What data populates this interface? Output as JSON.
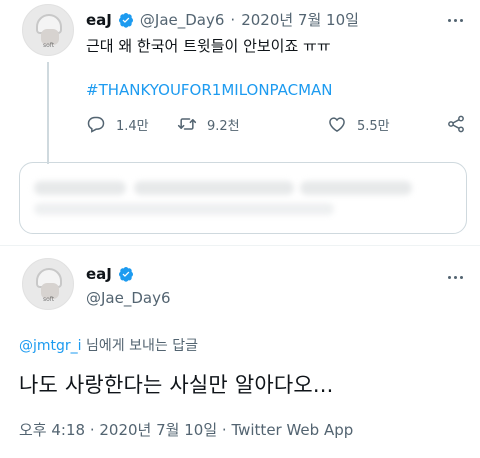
{
  "tweet1": {
    "display_name": "eaJ",
    "handle": "@Jae_Day6",
    "date_sep": "·",
    "date": "2020년 7월 10일",
    "text": "근대 왜 한국어 트윗들이 안보이죠 ㅠㅠ",
    "hashtag": "#THANKYOUFOR1MILONPACMAN",
    "avatar_caption": "soft",
    "actions": {
      "reply_count": "1.4만",
      "retweet_count": "9.2천",
      "like_count": "5.5만"
    }
  },
  "tweet2": {
    "display_name": "eaJ",
    "handle": "@Jae_Day6",
    "avatar_caption": "soft",
    "reply_to_mention": "@jmtgr_i",
    "reply_to_suffix": " 님에게 보내는 답글",
    "text": "나도 사랑한다는 사실만 알아다오...",
    "time": "오후 4:18",
    "meta_sep": " · ",
    "date": "2020년 7월 10일",
    "source": "Twitter Web App"
  },
  "colors": {
    "accent": "#1d9bf0",
    "muted": "#536471",
    "text": "#0f1419"
  },
  "icons": {
    "verified": "verified-badge-icon",
    "more": "more-horizontal-icon",
    "reply": "reply-icon",
    "retweet": "retweet-icon",
    "like": "heart-icon",
    "share": "share-icon"
  }
}
